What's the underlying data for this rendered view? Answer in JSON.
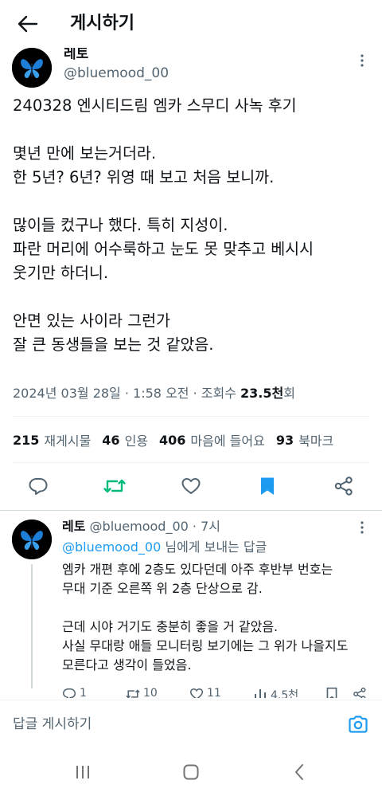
{
  "header": {
    "title": "게시하기"
  },
  "post": {
    "author": {
      "name": "레토",
      "handle": "@bluemood_00"
    },
    "lines": [
      "240328 엔시티드림 엠카 스무디 사녹 후기",
      "",
      "몇년 만에 보는거더라.",
      "한 5년? 6년? 위영 때 보고 처음 보니까.",
      "",
      "많이들 컸구나 했다. 특히 지성이.",
      "파란 머리에 어수룩하고 눈도 못 맞추고 베시시",
      "웃기만 하더니.",
      "",
      "안면 있는 사이라 그런가",
      "잘 큰 동생들을 보는 것 같았음."
    ],
    "meta": {
      "date": "2024년 03월 28일",
      "sep1": " · ",
      "time": "1:58 오전",
      "sep2": " · ",
      "views_label": "조회수 ",
      "views_num": "23.5천",
      "views_unit": "회"
    },
    "stats": [
      {
        "num": "215",
        "label": "재게시물"
      },
      {
        "num": "46",
        "label": "인용"
      },
      {
        "num": "406",
        "label": "마음에 들어요"
      },
      {
        "num": "93",
        "label": "북마크"
      }
    ]
  },
  "reply": {
    "name": "레토",
    "handle": "@bluemood_00",
    "dot": " · ",
    "time": "7시",
    "reply_to_mention": "@bluemood_00",
    "reply_to_suffix": " 님에게 보내는 답글",
    "lines": [
      "엠카 개편 후에 2층도 있다던데 아주 후반부 번호는",
      "무대 기준 오른쪽 위 2층 단상으로 감.",
      "",
      "근데 시야 거기도 충분히 좋을 거 같았음.",
      "사실 무대랑 애들 모니터링 보기에는 그 위가 나을지도",
      "모른다고 생각이 들었음."
    ],
    "counts": {
      "replies": "1",
      "reposts": "10",
      "likes": "11",
      "views": "4.5천"
    }
  },
  "compose": {
    "placeholder": "답글 게시하기"
  },
  "colors": {
    "accent": "#1d9bf0",
    "retweet_active": "#00ba7c",
    "muted": "#536471",
    "text": "#0f1419"
  },
  "icons": {
    "back": "arrow-left-icon",
    "more": "more-vertical-icon",
    "reply": "comment-icon",
    "repost": "repost-icon",
    "like": "heart-icon",
    "bookmark": "bookmark-icon",
    "share": "share-icon",
    "views": "bar-chart-icon",
    "camera": "camera-icon",
    "recents": "recents-icon",
    "home": "home-icon",
    "sys_back": "chevron-left-icon"
  }
}
